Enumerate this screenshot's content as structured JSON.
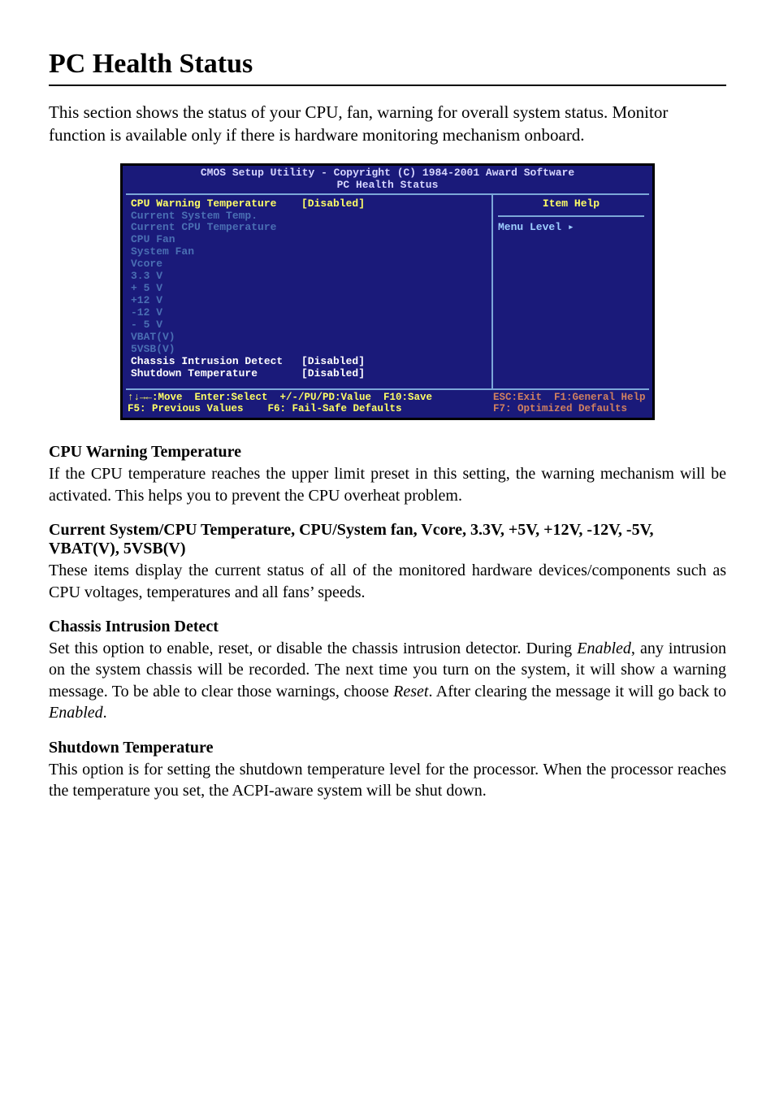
{
  "title": "PC Health Status",
  "intro": "This section shows the status of your CPU, fan, warning for overall system status.  Monitor function is available only if there is hardware monitoring mechanism onboard.",
  "bios": {
    "header_line1": "CMOS Setup Utility - Copyright (C) 1984-2001 Award Software",
    "header_line2": "PC Health Status",
    "left_rows": [
      {
        "style": "highlight",
        "label": "CPU Warning Temperature",
        "value": "[Disabled]"
      },
      {
        "style": "dim",
        "label": "Current System Temp.",
        "value": ""
      },
      {
        "style": "dim",
        "label": "Current CPU Temperature",
        "value": ""
      },
      {
        "style": "dim",
        "label": "CPU Fan",
        "value": ""
      },
      {
        "style": "dim",
        "label": "System Fan",
        "value": ""
      },
      {
        "style": "dim",
        "label": "Vcore",
        "value": ""
      },
      {
        "style": "dim",
        "label": "3.3 V",
        "value": ""
      },
      {
        "style": "dim",
        "label": "+ 5 V",
        "value": ""
      },
      {
        "style": "dim",
        "label": "+12 V",
        "value": ""
      },
      {
        "style": "dim",
        "label": "-12 V",
        "value": ""
      },
      {
        "style": "dim",
        "label": "- 5 V",
        "value": ""
      },
      {
        "style": "dim",
        "label": "VBAT(V)",
        "value": ""
      },
      {
        "style": "dim",
        "label": "5VSB(V)",
        "value": ""
      },
      {
        "style": "normal",
        "label": "Chassis Intrusion Detect",
        "value": "[Disabled]"
      },
      {
        "style": "normal",
        "label": "Shutdown Temperature",
        "value": "[Disabled]"
      }
    ],
    "right_title": "Item Help",
    "right_body": "Menu Level   ▸",
    "footer_left_line1": "↑↓→←:Move  Enter:Select  +/-/PU/PD:Value  F10:Save",
    "footer_left_line2": "F5: Previous Values    F6: Fail-Safe Defaults",
    "footer_right_line1": "ESC:Exit  F1:General Help",
    "footer_right_line2": "F7: Optimized Defaults"
  },
  "sections": [
    {
      "heading": "CPU Warning Temperature",
      "body_html": "If the CPU temperature reaches the upper limit preset in this setting, the warning mechanism will be activated. This helps you to prevent the CPU overheat problem."
    },
    {
      "heading": "Current System/CPU Temperature, CPU/System fan, Vcore, 3.3V, +5V, +12V, -12V, -5V, VBAT(V), 5VSB(V)",
      "body_html": "These items display the current status of all of the monitored hardware devices/components such as CPU voltages, temperatures and all fans’ speeds."
    },
    {
      "heading": "Chassis Intrusion Detect",
      "body_html": "Set this option to enable, reset, or disable the chassis intrusion detector. During <em>Enabled</em>, any intrusion on the system chassis will be recorded. The next time you turn on the system, it will show a warning message. To be able to clear those warnings, choose <em>Reset</em>. After clearing the message it will go back to <em>Enabled</em>."
    },
    {
      "heading": "Shutdown Temperature",
      "body_html": "This option is for setting the shutdown temperature level for the processor. When the processor reaches the temperature you set, the ACPI-aware system will be shut down."
    }
  ]
}
